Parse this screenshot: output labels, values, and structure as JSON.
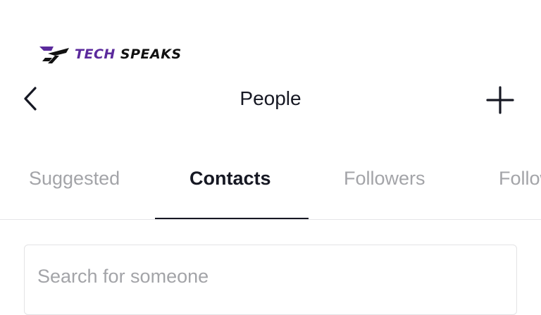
{
  "logo": {
    "word1": "TECH",
    "word2": "SPEAKS",
    "accent_color": "#5b2a9c",
    "dark_color": "#111111"
  },
  "header": {
    "title": "People",
    "back_icon": "chevron-left-icon",
    "add_icon": "plus-icon"
  },
  "tabs": [
    {
      "label": "Suggested",
      "active": false
    },
    {
      "label": "Contacts",
      "active": true
    },
    {
      "label": "Followers",
      "active": false
    },
    {
      "label": "Following",
      "active": false
    }
  ],
  "search": {
    "value": "",
    "placeholder": "Search for someone"
  },
  "colors": {
    "text_primary": "#161823",
    "text_secondary": "#a3a4a8",
    "divider": "#e6e6e8"
  }
}
